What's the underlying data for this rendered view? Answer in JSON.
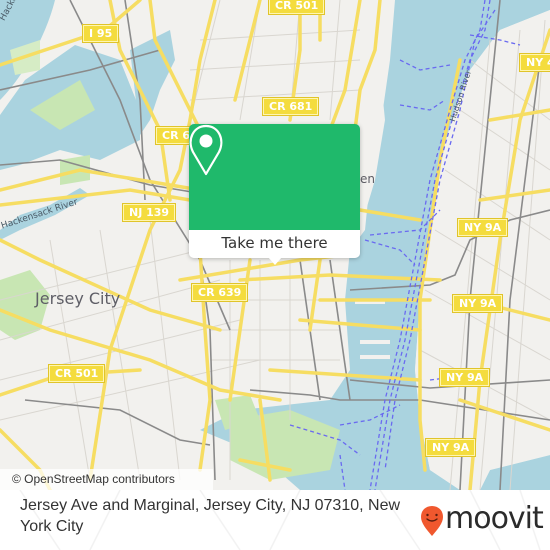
{
  "map": {
    "colors": {
      "land": "#f2f1ee",
      "water": "#aad3df",
      "park": "#c8e6b3",
      "road": "#f6dd62",
      "rail": "#8a8a8a",
      "ferry": "#6a6af0",
      "popup": "#1fb96b"
    },
    "place_labels": {
      "jersey_city": "Jersey City",
      "hoboken_partial": "en"
    },
    "river_labels": {
      "hackensack_top": "Hackensack",
      "hackensack_river": "Hackensack River",
      "hudson_river": "Hudson River"
    },
    "road_shields": {
      "i95": "I 95",
      "cr501_top": "CR 501",
      "cr681": "CR 681",
      "cr65x": "CR 65",
      "nj139": "NJ 139",
      "cr639": "CR 639",
      "cr501_bottom": "CR 501",
      "ny4x": "NY 4",
      "ny9a_1": "NY 9A",
      "ny9a_2": "NY 9A",
      "ny9a_3": "NY 9A",
      "ny9a_4": "NY 9A"
    },
    "attribution": "© OpenStreetMap contributors"
  },
  "popup": {
    "icon": "map-pin-icon",
    "button_label": "Take me there"
  },
  "footer": {
    "address": "Jersey Ave and Marginal, Jersey City, NJ 07310, New York City",
    "logo_text": "moovit",
    "logo_color": "#f0582e"
  }
}
